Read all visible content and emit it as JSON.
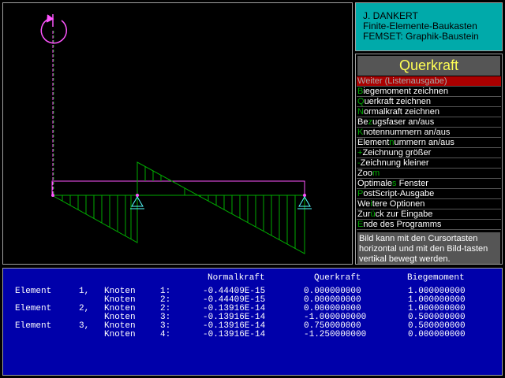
{
  "info": {
    "line1": "J. DANKERT",
    "line2": "Finite-Elemente-Baukasten",
    "line3": "FEMSET:  Graphik-Baustein"
  },
  "menu": {
    "title": "Querkraft",
    "items": [
      {
        "pre": "",
        "key": "W",
        "post": "eiter (Listenausgabe)",
        "selected": true
      },
      {
        "pre": "",
        "key": "B",
        "post": "iegemoment zeichnen"
      },
      {
        "pre": "",
        "key": "Q",
        "post": "uerkraft zeichnen"
      },
      {
        "pre": "",
        "key": "N",
        "post": "ormalkraft zeichnen"
      },
      {
        "pre": "Be",
        "key": "z",
        "post": "ugsfaser an/aus"
      },
      {
        "pre": "",
        "key": "K",
        "post": "notennummern  an/aus"
      },
      {
        "pre": "Element",
        "key": "n",
        "post": "ummern an/aus"
      },
      {
        "pre": "",
        "key": "+",
        "post": "Zeichnung größer"
      },
      {
        "pre": "",
        "key": "-",
        "post": "Zeichnung kleiner"
      },
      {
        "pre": "Zoo",
        "key": "m",
        "post": ""
      },
      {
        "pre": "Optimale",
        "key": "s",
        "post": " Fenster"
      },
      {
        "pre": "",
        "key": "P",
        "post": "ostScript-Ausgabe"
      },
      {
        "pre": "We",
        "key": "i",
        "post": "tere Optionen"
      },
      {
        "pre": "Zur",
        "key": "ü",
        "post": "ck zur Eingabe"
      },
      {
        "pre": "",
        "key": "E",
        "post": "nde des Programms"
      }
    ],
    "hint": "Bild kann mit den Cursortasten horizontal und mit den Bild-tasten vertikal bewegt werden."
  },
  "results": {
    "headers": [
      "Normalkraft",
      "Querkraft",
      "Biegemoment"
    ],
    "rows": [
      {
        "element": "Element",
        "enr": "1,",
        "knoten": "Knoten",
        "k": "1:",
        "n": "-0.44409E-15",
        "q": "0.000000000",
        "m": "1.000000000"
      },
      {
        "element": "",
        "enr": "",
        "knoten": "Knoten",
        "k": "2:",
        "n": "-0.44409E-15",
        "q": "0.000000000",
        "m": "1.000000000"
      },
      {
        "element": "Element",
        "enr": "2,",
        "knoten": "Knoten",
        "k": "2:",
        "n": "-0.13916E-14",
        "q": "0.000000000",
        "m": "1.000000000"
      },
      {
        "element": "",
        "enr": "",
        "knoten": "Knoten",
        "k": "3:",
        "n": "-0.13916E-14",
        "q": "-1.000000000",
        "m": "0.500000000"
      },
      {
        "element": "Element",
        "enr": "3,",
        "knoten": "Knoten",
        "k": "3:",
        "n": "-0.13916E-14",
        "q": "0.750000000",
        "m": "0.500000000"
      },
      {
        "element": "",
        "enr": "",
        "knoten": "Knoten",
        "k": "4:",
        "n": "-0.13916E-14",
        "q": "-1.250000000",
        "m": "0.000000000"
      }
    ]
  },
  "colors": {
    "structure": "#ff55ff",
    "diagram": "#00aa00",
    "support": "#55ffff",
    "selected": "#aa0000"
  },
  "icons": [
    "rotation-arrow-icon",
    "support-triangle-icon"
  ]
}
